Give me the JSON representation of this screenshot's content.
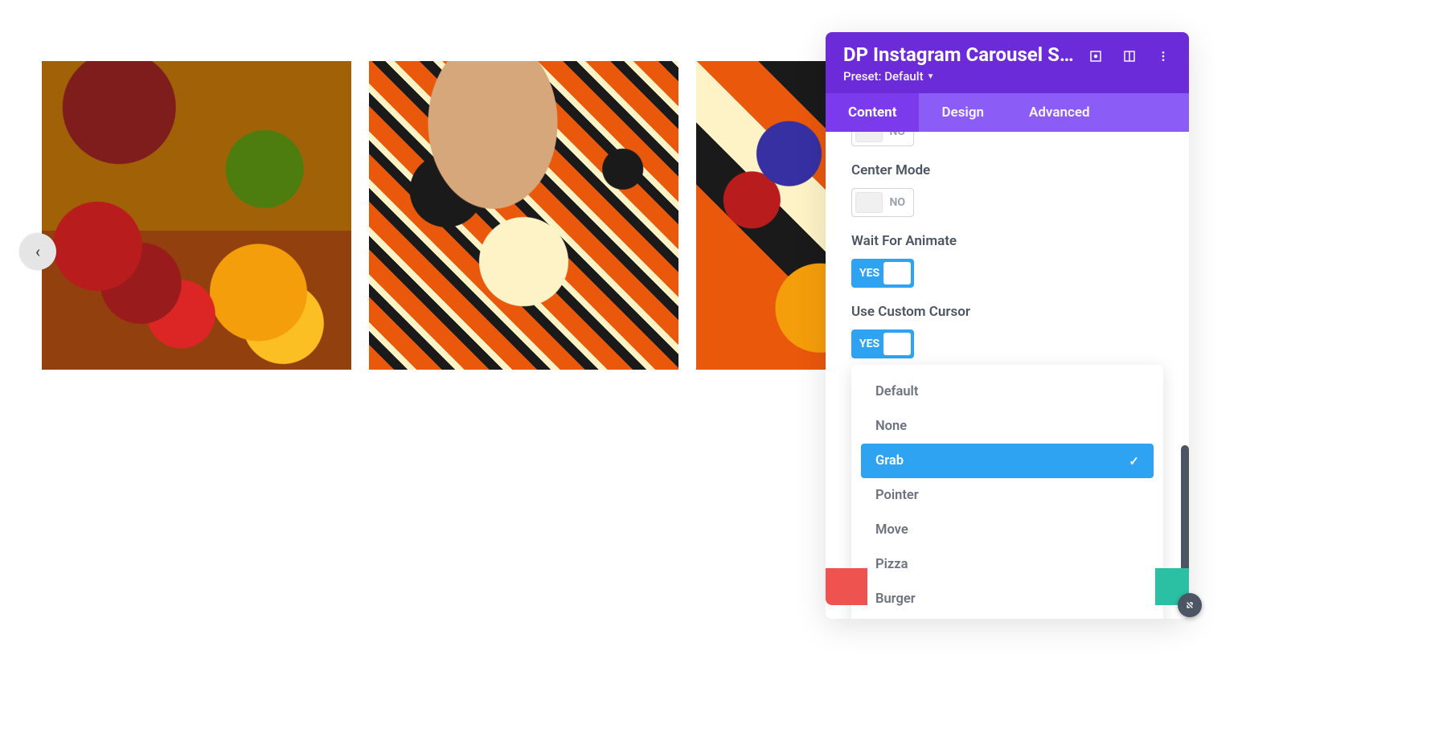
{
  "carousel": {
    "prev_icon": "‹"
  },
  "panel": {
    "title": "DP Instagram Carousel Sett…",
    "preset_label": "Preset: Default",
    "tabs": {
      "content": "Content",
      "design": "Design",
      "advanced": "Advanced"
    },
    "settings": {
      "cutoff_no": "NO",
      "center_mode": {
        "label": "Center Mode",
        "value": "NO"
      },
      "wait_for_animate": {
        "label": "Wait For Animate",
        "value": "YES"
      },
      "use_custom_cursor": {
        "label": "Use Custom Cursor",
        "value": "YES"
      }
    },
    "cursor_options": {
      "items": [
        "Default",
        "None",
        "Grab",
        "Pointer",
        "Move",
        "Pizza",
        "Burger"
      ],
      "selected": "Grab"
    }
  }
}
